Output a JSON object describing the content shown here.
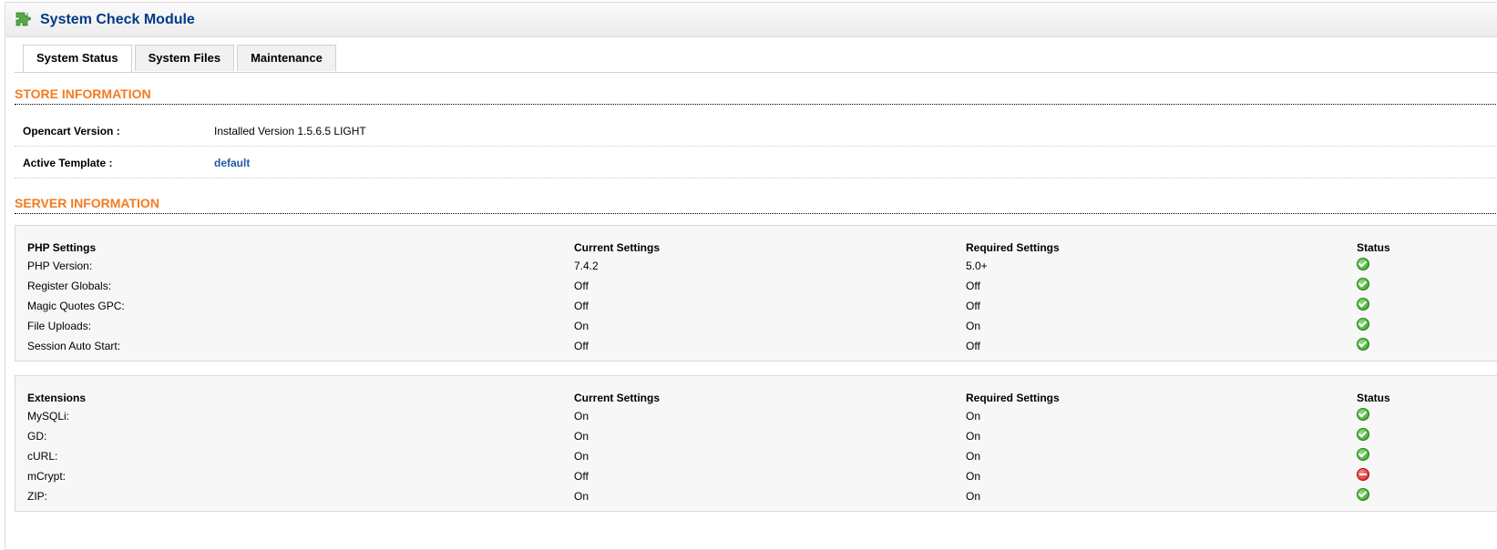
{
  "module": {
    "title": "System Check Module",
    "icon": "puzzle-icon"
  },
  "tabs": [
    {
      "label": "System Status",
      "active": true
    },
    {
      "label": "System Files",
      "active": false
    },
    {
      "label": "Maintenance",
      "active": false
    }
  ],
  "store": {
    "title": "STORE INFORMATION",
    "version_label": "Opencart Version :",
    "version_value": "Installed Version 1.5.6.5 LIGHT",
    "template_label": "Active Template :",
    "template_value": "default"
  },
  "server": {
    "title": "SERVER INFORMATION",
    "php": {
      "headers": [
        "PHP Settings",
        "Current Settings",
        "Required Settings",
        "Status"
      ],
      "rows": [
        {
          "name": "PHP Version:",
          "current": "7.4.2",
          "required": "5.0+",
          "status": "ok"
        },
        {
          "name": "Register Globals:",
          "current": "Off",
          "required": "Off",
          "status": "ok"
        },
        {
          "name": "Magic Quotes GPC:",
          "current": "Off",
          "required": "Off",
          "status": "ok"
        },
        {
          "name": "File Uploads:",
          "current": "On",
          "required": "On",
          "status": "ok"
        },
        {
          "name": "Session Auto Start:",
          "current": "Off",
          "required": "Off",
          "status": "ok"
        }
      ]
    },
    "extensions": {
      "headers": [
        "Extensions",
        "Current Settings",
        "Required Settings",
        "Status"
      ],
      "rows": [
        {
          "name": "MySQLi:",
          "current": "On",
          "required": "On",
          "status": "ok"
        },
        {
          "name": "GD:",
          "current": "On",
          "required": "On",
          "status": "ok"
        },
        {
          "name": "cURL:",
          "current": "On",
          "required": "On",
          "status": "ok"
        },
        {
          "name": "mCrypt:",
          "current": "Off",
          "required": "On",
          "status": "error"
        },
        {
          "name": "ZIP:",
          "current": "On",
          "required": "On",
          "status": "ok"
        }
      ]
    }
  },
  "colors": {
    "accent": "#f47a20",
    "title": "#003a88",
    "link": "#1d5aa5",
    "ok": "#2f9a1f",
    "error": "#d01818"
  }
}
